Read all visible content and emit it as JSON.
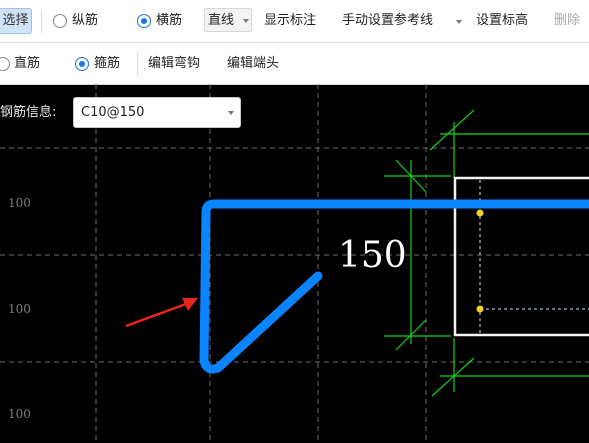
{
  "toolbar1": {
    "select_label": "选择",
    "longitudinal_label": "纵筋",
    "transverse_label": "横筋",
    "line_type_value": "直线",
    "show_annotation_label": "显示标注",
    "manual_reference_label": "手动设置参考线",
    "set_elevation_label": "设置标高",
    "delete_label": "删除"
  },
  "toolbar2": {
    "straight_bar_label": "直筋",
    "stirrup_label": "箍筋",
    "edit_bend_label": "编辑弯钩",
    "edit_end_label": "编辑端头"
  },
  "info": {
    "label": "钢筋信息:",
    "value": "C10@150"
  },
  "canvas": {
    "dim_labels": [
      "100",
      "100",
      "100"
    ],
    "hook_label": "150",
    "colors": {
      "rebar": "#0a84ff",
      "dimension": "#18d218",
      "arrow": "#e8251c",
      "grid": "#6e6e6e",
      "node": "#f2d22b"
    }
  }
}
